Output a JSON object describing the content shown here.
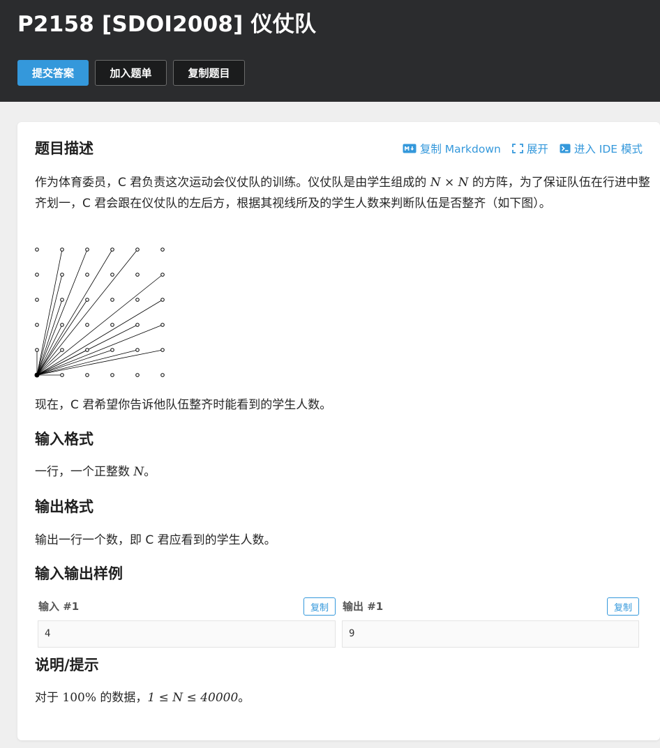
{
  "header": {
    "title": "P2158 [SDOI2008] 仪仗队",
    "buttons": {
      "submit": "提交答案",
      "add_to_list": "加入题单",
      "copy_problem": "复制题目"
    }
  },
  "toolbar": {
    "copy_markdown": "复制 Markdown",
    "expand": "展开",
    "ide_mode": "进入 IDE 模式"
  },
  "description": {
    "heading": "题目描述",
    "para1_a": "作为体育委员，C 君负责这次运动会仪仗队的训练。仪仗队是由学生组成的 ",
    "para1_math": "N × N",
    "para1_b": " 的方阵，为了保证队伍在行进中整齐划一，C 君会跟在仪仗队的左后方，根据其视线所及的学生人数来判断队伍是否整齐（如下图）。",
    "para2": "现在，C 君希望你告诉他队伍整齐时能看到的学生人数。"
  },
  "input_format": {
    "heading": "输入格式",
    "text_a": "一行，一个正整数 ",
    "text_math": "N",
    "text_b": "。"
  },
  "output_format": {
    "heading": "输出格式",
    "text": "输出一行一个数，即 C 君应看到的学生人数。"
  },
  "samples": {
    "heading": "输入输出样例",
    "input_label": "输入 #1",
    "output_label": "输出 #1",
    "copy_label": "复制",
    "input_value": "4",
    "output_value": "9"
  },
  "hint": {
    "heading": "说明/提示",
    "text_a": "对于 ",
    "math_pct": "100%",
    "text_b": " 的数据，",
    "math_range": "1 ≤ N ≤ 40000",
    "text_c": "。"
  },
  "colors": {
    "header_bg": "#2b2c2e",
    "accent": "#3498db",
    "page_bg": "#efefef"
  },
  "icons": [
    "markdown-icon",
    "expand-icon",
    "terminal-icon"
  ]
}
